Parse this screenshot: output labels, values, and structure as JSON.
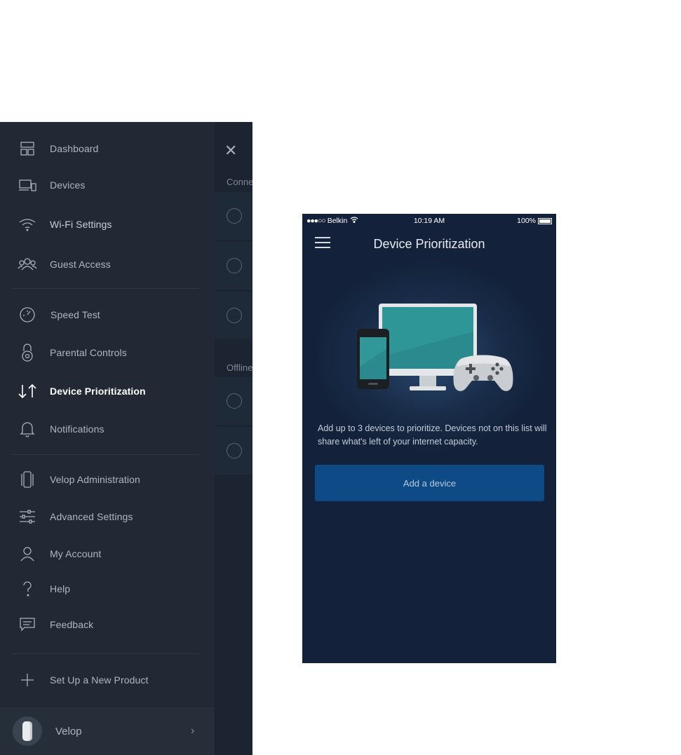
{
  "sidebar": {
    "items": [
      {
        "label": "Dashboard",
        "icon": "dashboard-icon"
      },
      {
        "label": "Devices",
        "icon": "devices-icon"
      },
      {
        "label": "Wi-Fi Settings",
        "icon": "wifi-icon"
      },
      {
        "label": "Guest Access",
        "icon": "guest-access-icon"
      },
      {
        "label": "Speed Test",
        "icon": "speedometer-icon"
      },
      {
        "label": "Parental Controls",
        "icon": "lock-icon"
      },
      {
        "label": "Device Prioritization",
        "icon": "prioritization-arrows-icon",
        "active": true
      },
      {
        "label": "Notifications",
        "icon": "bell-icon"
      },
      {
        "label": "Velop Administration",
        "icon": "velop-administration-icon"
      },
      {
        "label": "Advanced Settings",
        "icon": "sliders-icon"
      },
      {
        "label": "My Account",
        "icon": "person-icon"
      },
      {
        "label": "Help",
        "icon": "question-icon"
      },
      {
        "label": "Feedback",
        "icon": "feedback-icon"
      },
      {
        "label": "Set Up a New Product",
        "icon": "plus-icon"
      }
    ],
    "footer": {
      "label": "Velop"
    }
  },
  "background_panel": {
    "section_connected": "Conne",
    "section_offline": "Offline"
  },
  "phone": {
    "status_bar": {
      "carrier": "Belkin",
      "time": "10:19 AM",
      "battery": "100%"
    },
    "title": "Device Prioritization",
    "description": "Add up to 3 devices to prioritize. Devices not on this list will share what's left of your internet capacity.",
    "add_button_label": "Add a device"
  },
  "colors": {
    "sidebar_bg": "#222935",
    "phone_bg": "#13223a",
    "button_bg": "#0d4a86"
  }
}
